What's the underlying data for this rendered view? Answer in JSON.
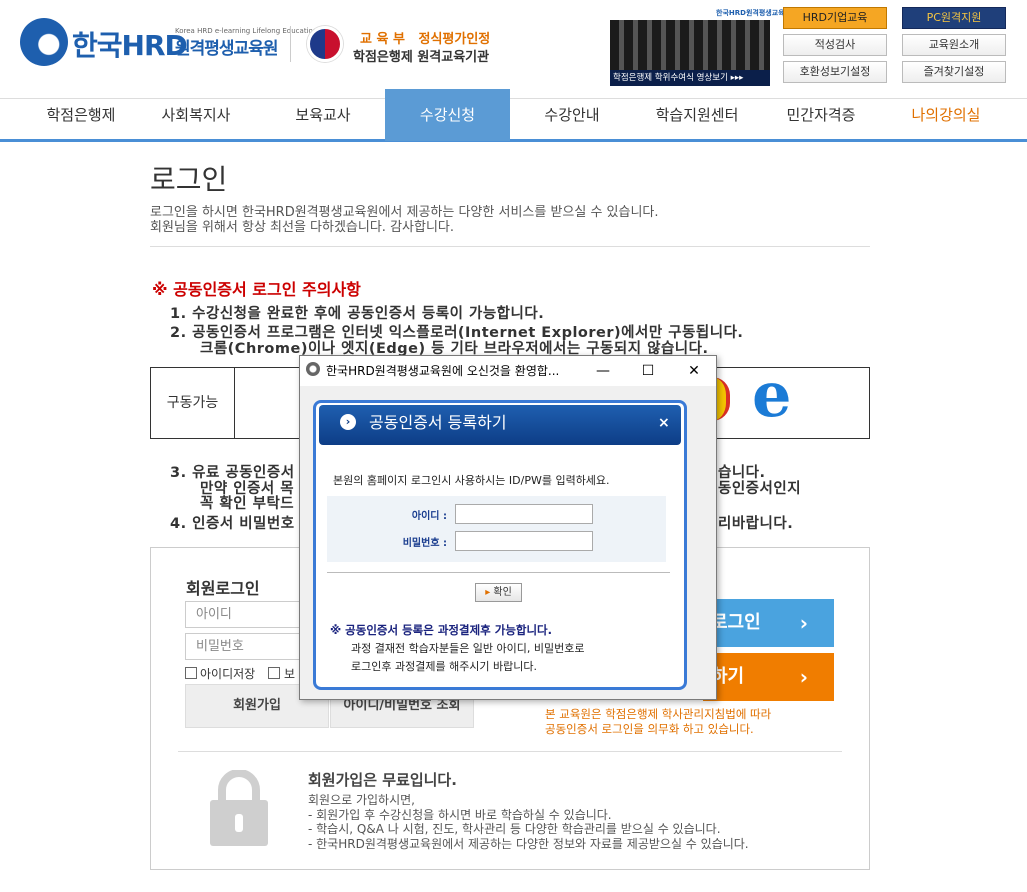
{
  "header": {
    "logo_main": "한국HRD",
    "logo_sub": "Korea HRD e-learning Lifelong Education",
    "logo_name": "원격평생교육원",
    "moe_line1": "교 육 부   정식평가인정",
    "moe_line2": "학점은행제 원격교육기관",
    "banner_logo": "한국HRD원격평생교육원",
    "banner_caption": "학점은행제 학위수여식 영상보기 ▸▸▸",
    "buttons": {
      "corp": "HRD기업교육",
      "pc": "PC원격지원",
      "aptitude": "적성검사",
      "intro": "교육원소개",
      "compat": "호환성보기설정",
      "favorite": "즐겨찾기설정"
    }
  },
  "nav": [
    "학점은행제",
    "사회복지사",
    "보육교사",
    "수강신청",
    "수강안내",
    "학습지원센터",
    "민간자격증",
    "나의강의실"
  ],
  "page": {
    "title": "로그인",
    "intro1": "로그인을 하시면 한국HRD원격평생교육원에서 제공하는 다양한 서비스를 받으실 수 있습니다.",
    "intro2": "회원님을 위해서 항상 최선을 다하겠습니다. 감사합니다.",
    "notice_title": "※ 공동인증서 로그인 주의사항",
    "notice1": "1. 수강신청을 완료한 후에 공동인증서 등록이 가능합니다.",
    "notice2a": "2. 공동인증서 프로그램은 인터넷 익스플로러(Internet Explorer)에서만 구동됩니다.",
    "notice2b": "크롬(Chrome)이나 엣지(Edge) 등 기타 브라우저에서는 구동되지 않습니다.",
    "browser_label": "구동가능",
    "notice3a": "3. 유료 공동인증서",
    "notice3a_end": "습니다.",
    "notice3b": "만약 인증서 목",
    "notice3b_end": "동인증서인지",
    "notice3c": "꼭 확인 부탁드",
    "notice4": "4. 인증서 비밀번호",
    "notice4_end": "리바랍니다."
  },
  "login": {
    "title": "회원로그인",
    "id_placeholder": "아이디",
    "pw_placeholder": "비밀번호",
    "save_id": "아이디저장",
    "save_pw": "보",
    "join_button": "회원가입",
    "find_button": "아이디/비밀번호 조회",
    "cert_login": "로그인",
    "cert_register": "하기",
    "cert_note1": "본 교육원은 학점은행제 학사관리지침법에 따라",
    "cert_note2": "공동인증서 로그인을 의무화 하고 있습니다.",
    "free_title": "회원가입은 무료입니다.",
    "free_lines": [
      "회원으로 가입하시면,",
      "- 회원가입 후 수강신청을 하시면 바로 학습하실 수 있습니다.",
      "- 학습시, Q&A 나 시험, 진도, 학사관리 등 다양한 학습관리를 받으실 수 있습니다.",
      "- 한국HRD원격평생교육원에서 제공하는 다양한 정보와 자료를 제공받으실 수 있습니다."
    ]
  },
  "popup": {
    "window_title": "한국HRD원격평생교육원에 오신것을 환영합...",
    "min": "—",
    "max": "☐",
    "close": "✕",
    "dialog_title": "공동인증서 등록하기",
    "dialog_close": "×",
    "instruction": "본원의 홈페이지 로그인시 사용하시는 ID/PW를 입력하세요.",
    "id_label": "아이디 :",
    "pw_label": "비밀번호 :",
    "ok_button": "확인",
    "note_title": "※ 공동인증서 등록은 과정결제후 가능합니다.",
    "note_line1": "과정 결재전 학습자분들은 일반 아이디, 비밀번호로",
    "note_line2": "로그인후 과정결제를 해주시기 바랍니다."
  },
  "colors": {
    "brand_blue": "#1e5fae",
    "nav_active": "#5b9bd5",
    "orange": "#f07d00",
    "sky": "#4aa3df",
    "dialog_blue": "#0d3d86"
  }
}
